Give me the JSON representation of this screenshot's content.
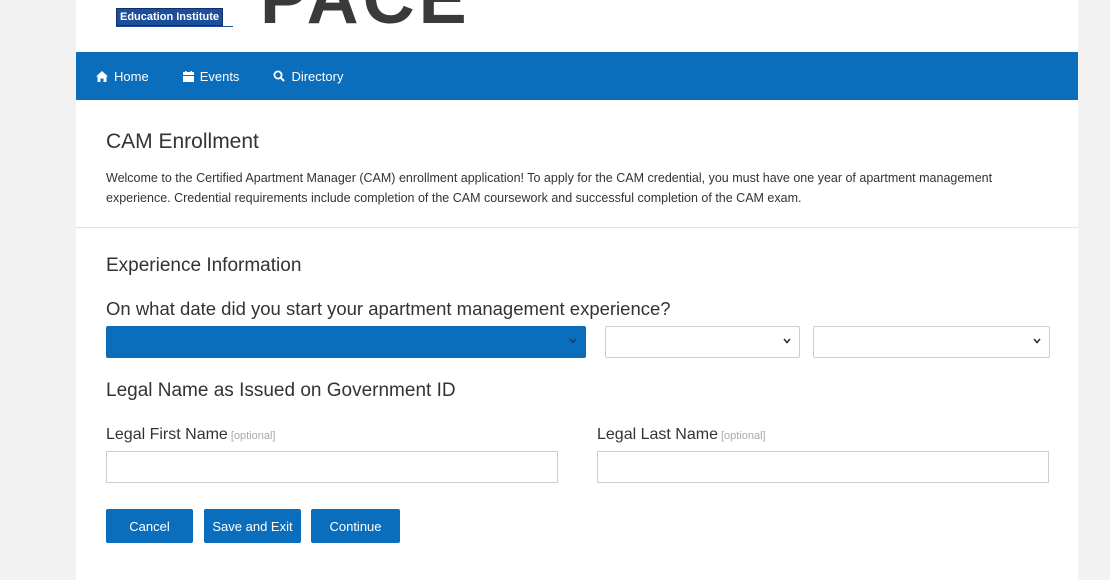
{
  "logo": {
    "badge_text": "Education Institute",
    "word": "PACE"
  },
  "nav": {
    "items": [
      {
        "label": "Home",
        "icon": "home-icon"
      },
      {
        "label": "Events",
        "icon": "calendar-icon"
      },
      {
        "label": "Directory",
        "icon": "search-icon"
      }
    ]
  },
  "intro": {
    "title": "CAM Enrollment",
    "description": "Welcome to the Certified Apartment Manager (CAM) enrollment application!  To apply for the CAM credential, you must have one year of apartment management experience.  Credential requirements include completion of the CAM coursework and successful completion of the CAM exam."
  },
  "experience": {
    "section_title": "Experience Information",
    "question": "On what date did you start your apartment management experience?",
    "month_value": "",
    "day_value": "",
    "year_value": ""
  },
  "legal_name": {
    "section_title": "Legal Name as Issued on Government ID",
    "first_label": "Legal First Name",
    "last_label": "Legal Last Name",
    "optional_text": "[optional]",
    "first_value": "",
    "last_value": ""
  },
  "buttons": {
    "cancel": "Cancel",
    "save_exit": "Save and Exit",
    "continue": "Continue"
  },
  "colors": {
    "primary": "#0a6ebd",
    "background": "#f2f2f2"
  }
}
